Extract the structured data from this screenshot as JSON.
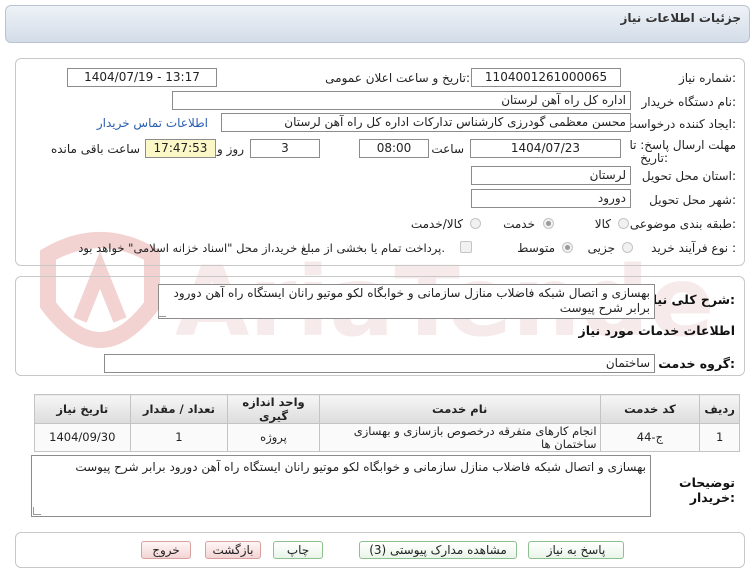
{
  "header": {
    "title": "جزئیات اطلاعات نیاز"
  },
  "fields": {
    "need_number_label": "شماره نیاز:",
    "need_number": "1104001261000065",
    "announce_label": "تاریخ و ساعت اعلان عمومی:",
    "announce_value": "1404/07/19 - 13:17",
    "buyer_org_label": "نام دستگاه خریدار:",
    "buyer_org": "اداره کل راه آهن لرستان",
    "requester_label": "ایجاد کننده درخواست:",
    "requester": "محسن معظمی گودرزی کارشناس تدارکات اداره کل راه آهن لرستان",
    "contact_link": "اطلاعات تماس خریدار",
    "deadline_label_1": "مهلت ارسال پاسخ: تا",
    "deadline_label_2": "تاریخ:",
    "deadline_date": "1404/07/23",
    "time_label": "ساعت",
    "deadline_time": "08:00",
    "days_value": "3",
    "days_label": "روز و",
    "remaining_time": "17:47:53",
    "remaining_label": "ساعت باقی مانده",
    "province_label": "استان محل تحویل:",
    "province": "لرستان",
    "city_label": "شهر محل تحویل:",
    "city": "دورود",
    "category_label": "طبقه بندی موضوعی:",
    "category_options": [
      "کالا",
      "خدمت",
      "کالا/خدمت"
    ],
    "category_selected": "خدمت",
    "process_label": "نوع فرآیند خرید :",
    "process_options": [
      "جزیی",
      "متوسط"
    ],
    "process_selected": "متوسط",
    "payment_note": "پرداخت تمام یا بخشی از مبلغ خرید،از محل \"اسناد خزانه اسلامی\" خواهد بود."
  },
  "summary": {
    "label": "شرح کلی نیاز:",
    "text": "بهسازی و اتصال شبکه فاضلاب منازل سازمانی و خوابگاه لکو موتیو رانان ایستگاه راه آهن دورود برابر شرح پیوست"
  },
  "services": {
    "title": "اطلاعات خدمات مورد نیاز",
    "group_label": "گروه خدمت:",
    "group_value": "ساختمان",
    "columns": [
      "ردیف",
      "کد خدمت",
      "نام خدمت",
      "واحد اندازه گیری",
      "تعداد / مقدار",
      "تاریخ نیاز"
    ],
    "rows": [
      [
        "1",
        "ج-44",
        "انجام کارهای متفرقه درخصوص بازسازی و بهسازی ساختمان ها",
        "پروژه",
        "1",
        "1404/09/30"
      ]
    ]
  },
  "buyer_notes": {
    "label_1": "توضیحات",
    "label_2": "خریدار:",
    "text": "بهسازی و اتصال شبکه فاضلاب منازل سازمانی و خوابگاه لکو موتیو رانان ایستگاه راه آهن دورود برابر شرح پیوست"
  },
  "buttons": {
    "respond": "پاسخ به نیاز",
    "attachments": "مشاهده مدارک پیوستی (3)",
    "print": "چاپ",
    "back": "بازگشت",
    "exit": "خروج"
  },
  "colors": {
    "header_bg": "#d3dce8",
    "link": "#2a5db0",
    "remaining_bg": "#fbf7c6",
    "watermark": "#f3d2d2"
  }
}
